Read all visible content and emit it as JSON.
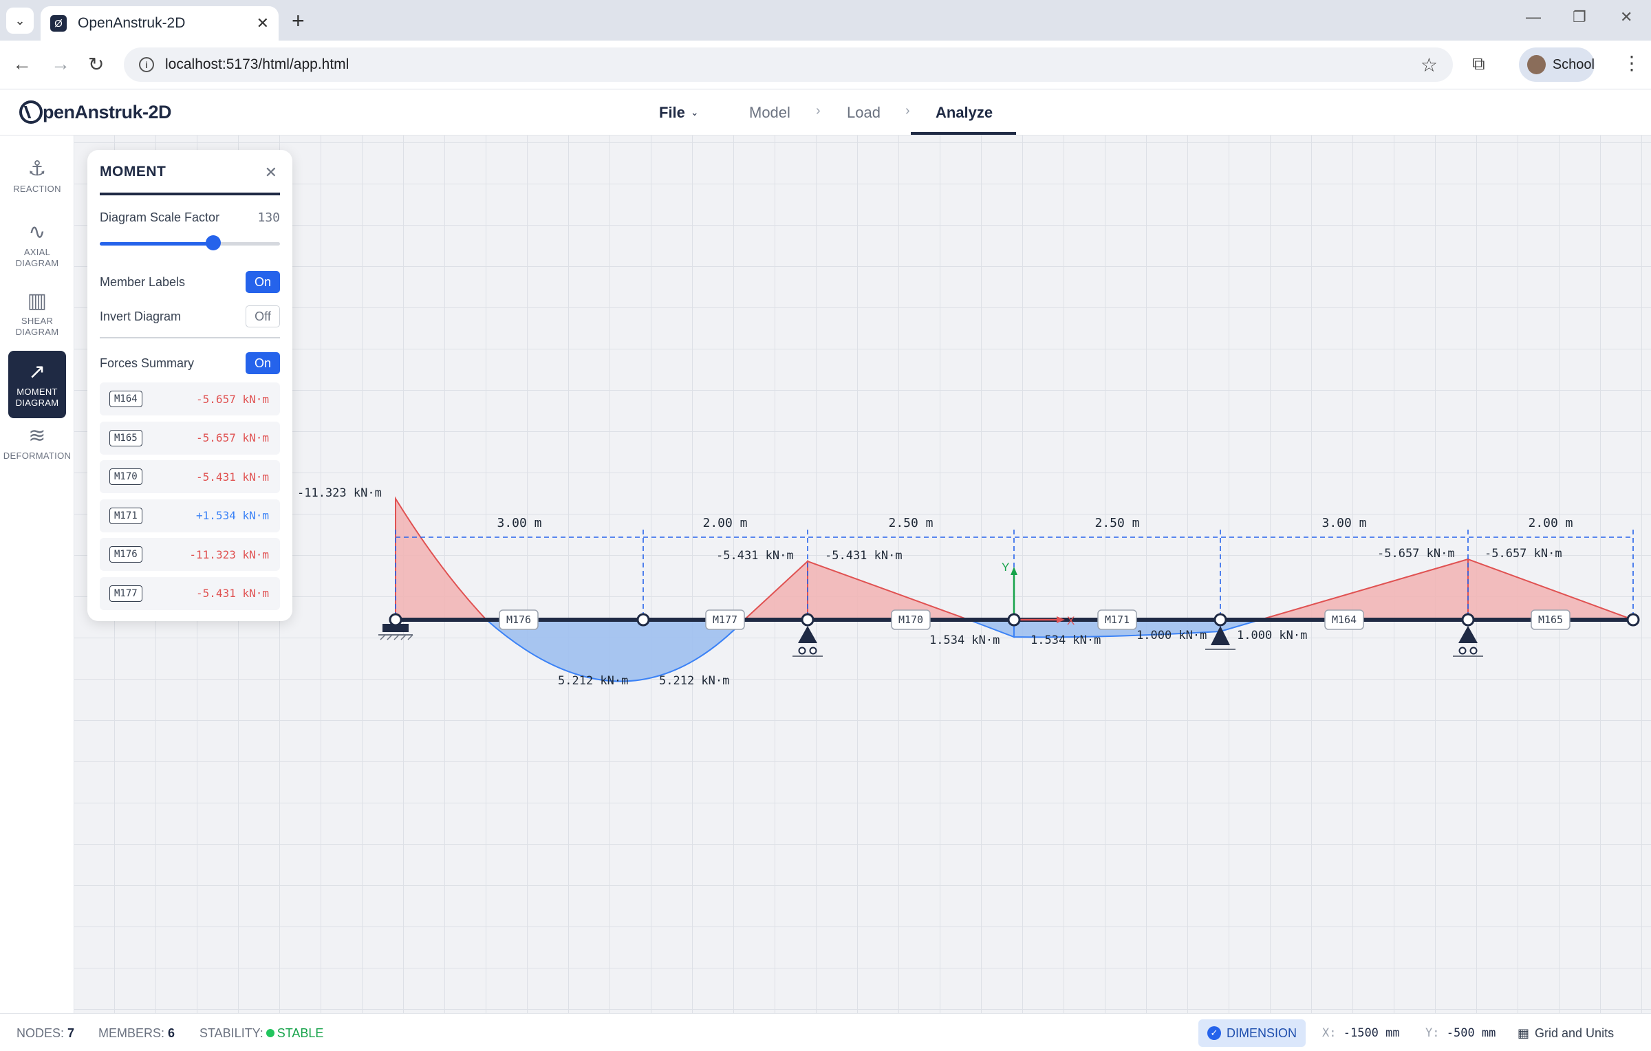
{
  "browser": {
    "tab_title": "OpenAnstruk-2D",
    "url": "localhost:5173/html/app.html",
    "profile_name": "School"
  },
  "app": {
    "logo_text": "penAnstruk-2D",
    "menu": {
      "file": "File",
      "model": "Model",
      "load": "Load",
      "analyze": "Analyze",
      "active": "Analyze"
    }
  },
  "toolbar": [
    {
      "label": "REACTION",
      "icon": "anchor-icon"
    },
    {
      "label": "AXIAL DIAGRAM",
      "icon": "axial-icon"
    },
    {
      "label": "SHEAR DIAGRAM",
      "icon": "bar-chart-icon"
    },
    {
      "label": "MOMENT DIAGRAM",
      "icon": "trend-icon",
      "active": true
    },
    {
      "label": "DEFORMATION",
      "icon": "wave-icon"
    }
  ],
  "panel": {
    "title": "MOMENT",
    "scale_label": "Diagram Scale Factor",
    "scale_value": "130",
    "scale_fraction": 0.63,
    "member_labels_label": "Member Labels",
    "member_labels_state": "On",
    "invert_label": "Invert Diagram",
    "invert_state": "Off",
    "forces_label": "Forces Summary",
    "forces_state": "On",
    "forces": [
      {
        "member": "M164",
        "value": "-5.657 kN·m"
      },
      {
        "member": "M165",
        "value": "-5.657 kN·m"
      },
      {
        "member": "M170",
        "value": "-5.431 kN·m"
      },
      {
        "member": "M171",
        "value": "+1.534 kN·m"
      },
      {
        "member": "M176",
        "value": "-11.323 kN·m"
      },
      {
        "member": "M177",
        "value": "-5.431 kN·m"
      }
    ]
  },
  "diagram": {
    "spans": [
      "3.00 m",
      "2.00 m",
      "2.50 m",
      "2.50 m",
      "3.00 m",
      "2.00 m"
    ],
    "member_labels": [
      "M176",
      "M177",
      "M170",
      "M171",
      "M164",
      "M165"
    ],
    "moment_labels": {
      "fixed_end": "-11.323 kN·m",
      "m177_end": "-5.431 kN·m",
      "m170_start": "-5.431 kN·m",
      "sag_left": "5.212 kN·m",
      "sag_right": "5.212 kN·m",
      "m170_end": "1.534 kN·m",
      "m171_start": "1.534 kN·m",
      "m171_end": "1.000 kN·m",
      "m164_start": "1.000 kN·m",
      "m164_end": "-5.657 kN·m",
      "m165_start": "-5.657 kN·m"
    },
    "axis_y": "Y",
    "axis_x": "X",
    "colors": {
      "negative": "#e05252",
      "positive": "#3b82f6",
      "beam": "#1f2a44",
      "dimension": "#2563eb"
    }
  },
  "status": {
    "nodes_label": "NODES:",
    "nodes_value": "7",
    "members_label": "MEMBERS:",
    "members_value": "6",
    "stability_label": "STABILITY:",
    "stability_value": "STABLE",
    "dimension_btn": "DIMENSION",
    "x_label": "X:",
    "x_value": "-1500 mm",
    "y_label": "Y:",
    "y_value": "-500 mm",
    "grid_units": "Grid and Units"
  }
}
